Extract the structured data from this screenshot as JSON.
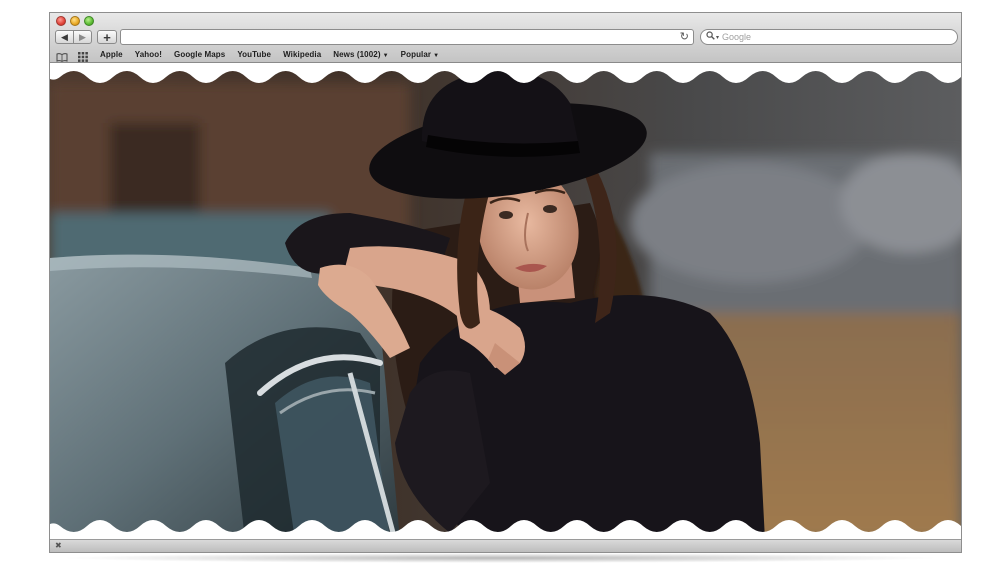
{
  "browser": {
    "address": {
      "value": ""
    },
    "search": {
      "placeholder": "Google"
    },
    "buttons": {
      "back_icon": "back-arrow-icon",
      "forward_icon": "forward-arrow-icon",
      "add_icon": "plus-icon",
      "reload_icon": "reload-icon"
    }
  },
  "bookmarks": [
    {
      "label": "Apple"
    },
    {
      "label": "Yahoo!"
    },
    {
      "label": "Google Maps"
    },
    {
      "label": "YouTube"
    },
    {
      "label": "Wikipedia"
    },
    {
      "label": "News (1002)",
      "has_menu": true
    },
    {
      "label": "Popular",
      "has_menu": true
    }
  ],
  "colors": {
    "traffic_close": "#e0443a",
    "traffic_minimize": "#e9a823",
    "traffic_maximize": "#5cbc34",
    "chrome": "#c9c9c9"
  }
}
